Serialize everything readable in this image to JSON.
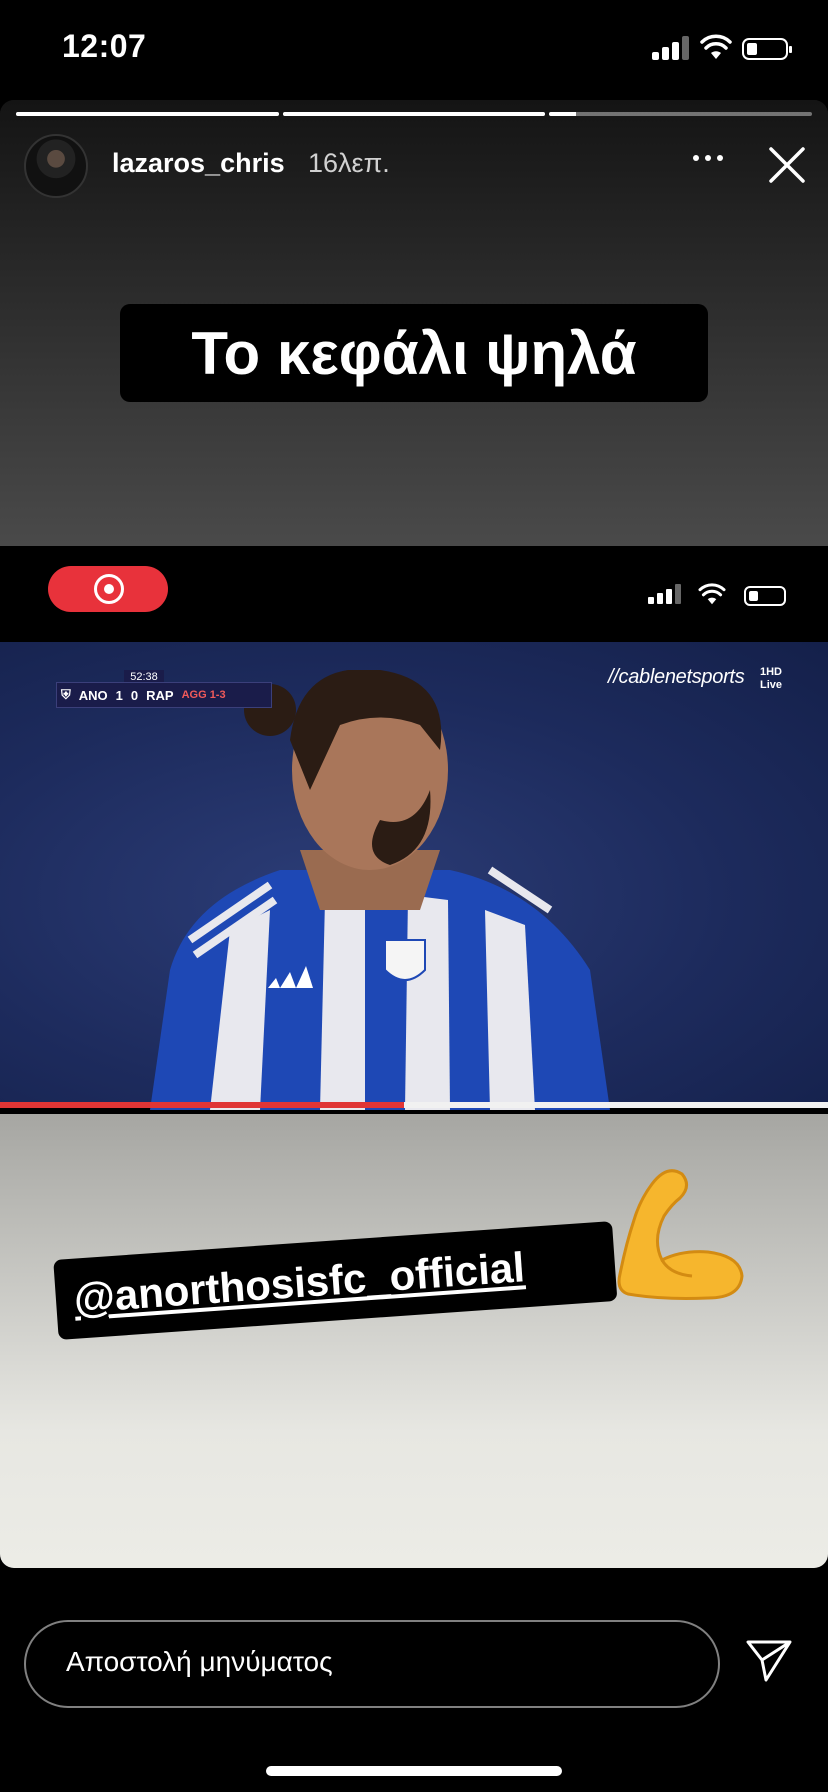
{
  "status_bar": {
    "time": "12:07",
    "battery_icon": "battery-icon",
    "wifi_icon": "wifi-icon",
    "signal_icon": "cellular-signal-icon"
  },
  "story": {
    "progress_segments": [
      1,
      1,
      0.1
    ],
    "username": "lazaros_chris",
    "posted_ago": "16λεπ.",
    "caption": "Το κεφάλι ψηλά",
    "mention": "@anorthosisfc_official",
    "emoji": "💪"
  },
  "embedded_screenshot": {
    "scorebug": {
      "clock": "52:38",
      "home": "ANO",
      "home_score": "1",
      "away_score": "0",
      "away": "RAP",
      "aggregate": "AGG 1-3"
    },
    "broadcaster": "//cablenetsports",
    "channel": "1HD",
    "live": "Live",
    "video_progress": 0.49
  },
  "reply": {
    "placeholder": "Αποστολή μηνύματος"
  },
  "colors": {
    "record_red": "#e8323b",
    "video_blue": "#1d2b5d"
  }
}
